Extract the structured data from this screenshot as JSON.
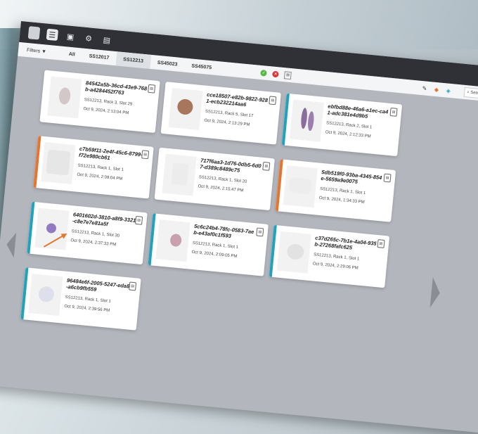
{
  "toolbar": {
    "buttons": [
      "menu-icon",
      "screen-icon",
      "gear-icon",
      "document-icon"
    ]
  },
  "filterbar": {
    "filters_label": "Filters",
    "tabs": [
      {
        "label": "All",
        "selected": false
      },
      {
        "label": "SS12017",
        "selected": false
      },
      {
        "label": "SS12213",
        "selected": true
      },
      {
        "label": "SS45023",
        "selected": false
      },
      {
        "label": "SS45075",
        "selected": false
      }
    ],
    "search_placeholder": "Search..."
  },
  "colors": {
    "orange": "#e8742b",
    "teal": "#1fa3bd"
  },
  "cards": [
    {
      "id": "84542a5b-36cd-43e9-768b-a4284452f763",
      "location": "SS12213, Rack 3, Slot 29",
      "date": "Oct 9, 2024, 2:13:04 PM",
      "stripe": ""
    },
    {
      "id": "cce18507-e82b-9822-9281-ecb232214aa6",
      "location": "SS12213, Rack 5, Slot 17",
      "date": "Oct 9, 2024, 2:13:29 PM",
      "stripe": ""
    },
    {
      "id": "ebfbd88e-46a6-a1ec-ca41-adc381e4d9b5",
      "location": "SS12213, Rack 2, Slot 1",
      "date": "Oct 9, 2024, 2:12:33 PM",
      "stripe": "teal"
    },
    {
      "id": "c7b59f11-2e4f-45c6-8799-f72e980cb61",
      "location": "SS12213, Rack 1, Slot 1",
      "date": "Oct 9, 2024, 2:08:04 PM",
      "stripe": "orange"
    },
    {
      "id": "717f6aa3-1d76-0db5-6d07-d389c8489c75",
      "location": "SS12213, Rack 1, Slot 20",
      "date": "Oct 9, 2024, 2:15:47 PM",
      "stripe": ""
    },
    {
      "id": "5db519f0-93ba-4345-854e-5659a9e0075",
      "location": "SS12213, Rack 1, Slot 1",
      "date": "Oct 9, 2024, 1:34:33 PM",
      "stripe": "orange"
    },
    {
      "id": "6401602d-3810-a8f9-3321-c8e7e7e81a5f",
      "location": "SS12213, Rack 1, Slot 30",
      "date": "Oct 9, 2024, 2:37:33 PM",
      "stripe": "teal"
    },
    {
      "id": "5c6c24b4-78fc-0583-7aeb-e43af0c1f593",
      "location": "SS12213, Rack 1, Slot 1",
      "date": "Oct 9, 2024, 2:09:05 PM",
      "stripe": "teal"
    },
    {
      "id": "c37d265c-7b1e-4a04-935b-27268fafc625",
      "location": "SS12213, Rack 1, Slot 1",
      "date": "Oct 9, 2024, 2:29:06 PM",
      "stripe": "teal"
    },
    {
      "id": "96484e6f-2005-5247-eda8-a6cb9fb559",
      "location": "SS12213, Rack 1, Slot 1",
      "date": "Oct 9, 2024, 2:39:56 PM",
      "stripe": "teal"
    }
  ]
}
